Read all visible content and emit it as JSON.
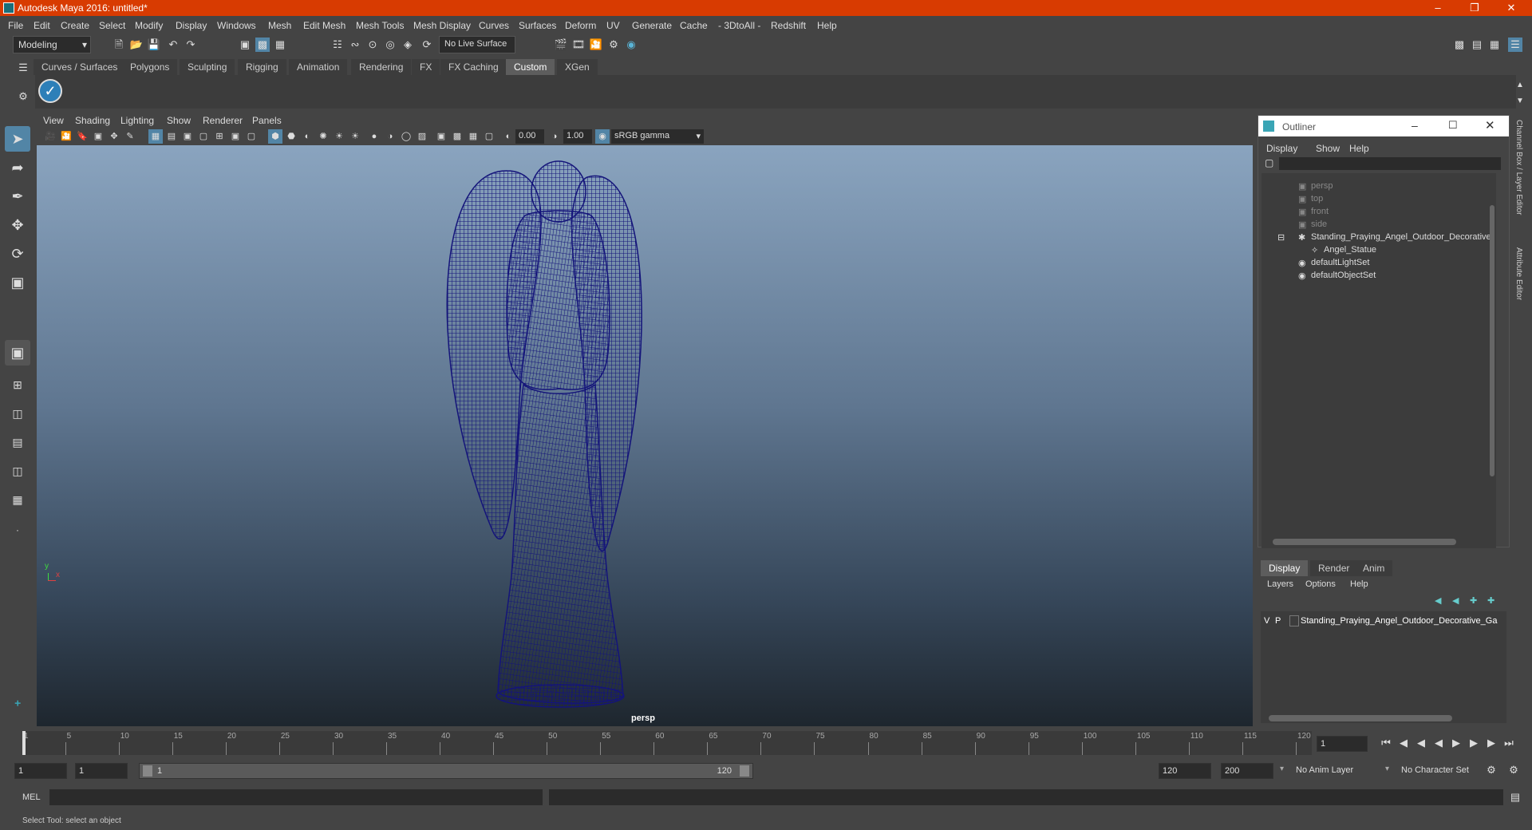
{
  "window": {
    "title": "Autodesk Maya 2016: untitled*"
  },
  "menu": [
    "File",
    "Edit",
    "Create",
    "Select",
    "Modify",
    "Display",
    "Windows",
    "Mesh",
    "Edit Mesh",
    "Mesh Tools",
    "Mesh Display",
    "Curves",
    "Surfaces",
    "Deform",
    "UV",
    "Generate",
    "Cache",
    "- 3DtoAll -",
    "Redshift",
    "Help"
  ],
  "status": {
    "mode": "Modeling",
    "live_surface": "No Live Surface"
  },
  "shelf_tabs": [
    "Curves / Surfaces",
    "Polygons",
    "Sculpting",
    "Rigging",
    "Animation",
    "Rendering",
    "FX",
    "FX Caching",
    "Custom",
    "XGen"
  ],
  "shelf_active": "Custom",
  "viewport": {
    "menu": [
      "View",
      "Shading",
      "Lighting",
      "Show",
      "Renderer",
      "Panels"
    ],
    "exposure": "0.00",
    "gamma": "1.00",
    "color_space": "sRGB gamma",
    "camera_label": "persp",
    "axis_y": "y",
    "axis_x": "x",
    "mesh_color": "#14147a"
  },
  "outliner": {
    "title": "Outliner",
    "menu": [
      "Display",
      "Show",
      "Help"
    ],
    "items": [
      {
        "label": "persp",
        "icon": "camera-icon"
      },
      {
        "label": "top",
        "icon": "camera-icon"
      },
      {
        "label": "front",
        "icon": "camera-icon"
      },
      {
        "label": "side",
        "icon": "camera-icon"
      },
      {
        "label": "Standing_Praying_Angel_Outdoor_Decorative",
        "icon": "group-icon"
      },
      {
        "label": "Angel_Statue",
        "icon": "mesh-icon"
      },
      {
        "label": "defaultLightSet",
        "icon": "set-icon"
      },
      {
        "label": "defaultObjectSet",
        "icon": "set-icon"
      }
    ]
  },
  "side_tabs": {
    "channel_box": "Channel Box / Layer Editor",
    "attribute_editor": "Attribute Editor"
  },
  "layer_editor": {
    "tabs": [
      "Display",
      "Render",
      "Anim"
    ],
    "active_tab": "Display",
    "menu": [
      "Layers",
      "Options",
      "Help"
    ],
    "layer": {
      "v": "V",
      "p": "P",
      "name": "Standing_Praying_Angel_Outdoor_Decorative_Ga"
    }
  },
  "timeline": {
    "ticks": [
      "1",
      "5",
      "10",
      "15",
      "20",
      "25",
      "30",
      "35",
      "40",
      "45",
      "50",
      "55",
      "60",
      "65",
      "70",
      "75",
      "80",
      "85",
      "90",
      "95",
      "100",
      "105",
      "110",
      "115",
      "120"
    ],
    "current_frame": "1"
  },
  "range": {
    "start": "1",
    "playback_start": "1",
    "slider_start": "1",
    "slider_end": "120",
    "playback_end": "120",
    "end": "200",
    "anim_layer": "No Anim Layer",
    "character_set": "No Character Set"
  },
  "command": {
    "label": "MEL"
  },
  "help_line": "Select Tool: select an object"
}
